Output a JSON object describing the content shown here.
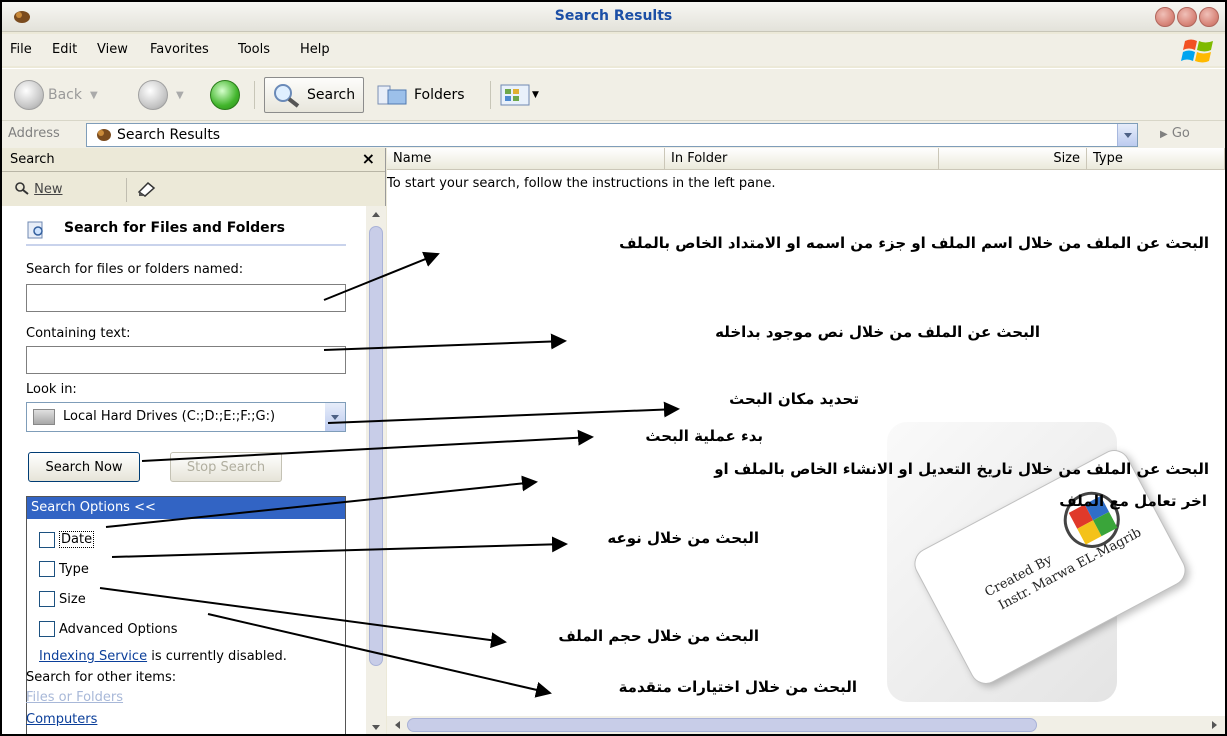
{
  "window": {
    "title": "Search Results"
  },
  "menu": [
    "File",
    "Edit",
    "View",
    "Favorites",
    "Tools",
    "Help"
  ],
  "toolbar": {
    "back": "Back",
    "search": "Search",
    "folders": "Folders"
  },
  "address": {
    "label": "Address",
    "value": "Search Results",
    "go": "Go"
  },
  "search_pane": {
    "header": "Search",
    "close": "×",
    "new": "New",
    "title": "Search for Files and Folders",
    "name_label": "Search for files or folders named:",
    "containing_label": "Containing text:",
    "lookin_label": "Look in:",
    "lookin_value": "Local Hard Drives (C:;D:;E:;F:;G:)",
    "search_now": "Search Now",
    "stop_search": "Stop Search",
    "options_header": "Search Options  <<",
    "options": [
      "Date",
      "Type",
      "Size",
      "Advanced Options"
    ],
    "indexing_link": "Indexing Service",
    "indexing_text": " is currently disabled.",
    "other_items": "Search for other items:",
    "files_or_folders": "Files or Folders",
    "computers": "Computers"
  },
  "results": {
    "columns": [
      "Name",
      "In Folder",
      "Size",
      "Type"
    ],
    "hint": "To start your search, follow the instructions in the left pane."
  },
  "annotations": {
    "a1": "البحث عن الملف من خلال اسم الملف او جزء من اسمه او الامتداد الخاص بالملف",
    "a2": "البحث عن الملف من خلال نص موجود بداخله",
    "a3": "تحديد مكان البحث",
    "a4": "بدء عملية البحث",
    "a5_line1": "البحث عن الملف من خلال تاريخ التعديل او الانشاء الخاص بالملف او",
    "a5_line2": "اخر تعامل مع الملف",
    "a6": "البحث من خلال نوعه",
    "a7": "البحث من خلال حجم الملف",
    "a8": "البحث من خلال اختيارات متقدمة"
  },
  "card": {
    "line1": "Created By",
    "line2": "Instr. Marwa EL-Magrib"
  },
  "icons": [
    "app-icon",
    "windows-logo-icon",
    "back-icon",
    "forward-icon",
    "up-icon",
    "search-icon",
    "folders-icon",
    "views-icon",
    "new-search-icon",
    "edit-icon",
    "search-files-icon",
    "drive-icon",
    "seal-icon"
  ]
}
